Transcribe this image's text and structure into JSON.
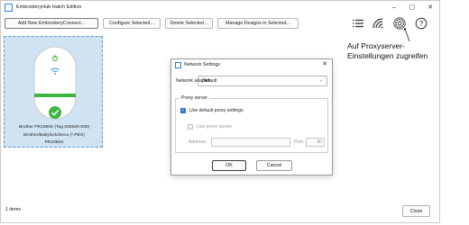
{
  "window": {
    "title": "EmbroideryHub Hatch Edition",
    "controls": [
      "–",
      "▢",
      "✕"
    ]
  },
  "toolbar": {
    "add_label": "Add New EmbroideryConnect...",
    "configure_label": "Configure Selected...",
    "delete_label": "Delete Selected...",
    "manage_label": "Manage Designs in Selected..."
  },
  "tool_icons": [
    "list-view-icon",
    "wifi-icon",
    "settings-gear-icon",
    "help-icon"
  ],
  "device": {
    "line1": "Brother PR1050X (Tag 000026-000)",
    "line2": "Brother/Babylock/Deco (*.PES)",
    "line3": "PR1050X",
    "status": "connected"
  },
  "status_bar": {
    "items": "1 items",
    "close_label": "Close"
  },
  "dialog": {
    "title": "Network Settings",
    "adapter_label": "Network adapter:",
    "adapter_value": "Default",
    "proxy_group": "Proxy server",
    "use_default_label": "Use default proxy settings",
    "use_default_checked": true,
    "use_proxy_label": "Use proxy server",
    "use_proxy_checked": false,
    "address_label": "Address:",
    "address_value": "",
    "port_label": "Port:",
    "port_value": "80",
    "ok_label": "OK",
    "cancel_label": "Cancel"
  },
  "callout": {
    "line1": "Auf Proxyserver-",
    "line2": "Einstellungen zugreifen"
  },
  "colors": {
    "selection": "#cfe3f3",
    "accent_green": "#3fb53f",
    "checkbox_blue": "#2e6fcf"
  }
}
